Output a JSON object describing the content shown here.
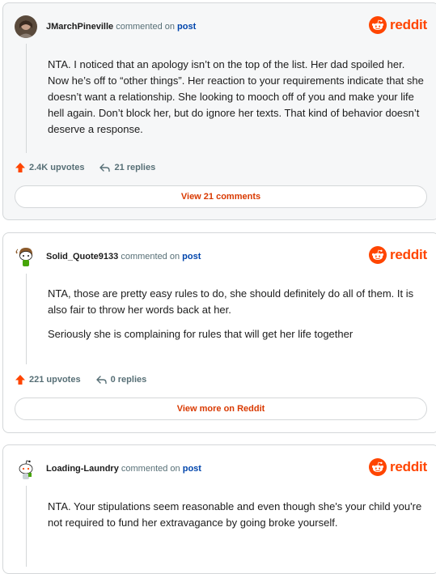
{
  "brand": {
    "wordmark": "reddit",
    "color": "#ff4500",
    "icon": "reddit-snoo-icon"
  },
  "comments": [
    {
      "user": "JMarchPineville",
      "action": "commented on",
      "target": "post",
      "avatar": "profile-photo-avatar",
      "paragraphs": [
        "NTA. I noticed that an apology isn’t on the top of the list. Her dad spoiled her. Now he’s off to “other things”. Her reaction to your requirements indicate that she doesn’t want a relationship. She looking to mooch off of you and make your life hell again. Don’t block her, but do ignore her texts. That kind of behavior doesn’t deserve a response."
      ],
      "upvotes": "2.4K upvotes",
      "replies": "21 replies",
      "cta": "View 21 comments"
    },
    {
      "user": "Solid_Quote9133",
      "action": "commented on",
      "target": "post",
      "avatar": "cartoon-snoo-avatar",
      "paragraphs": [
        "NTA, those are pretty easy rules to do, she should definitely do all of them. It is also fair to throw her words back at her.",
        "Seriously she is complaining for rules that will get her life together"
      ],
      "upvotes": "221 upvotes",
      "replies": "0 replies",
      "cta": "View more on Reddit"
    },
    {
      "user": "Loading-Laundry",
      "action": "commented on",
      "target": "post",
      "avatar": "snoo-avatar",
      "paragraphs": [
        "NTA. Your stipulations seem reasonable and even though she's your child you're not required to fund her extravagance by going broke yourself."
      ]
    }
  ]
}
